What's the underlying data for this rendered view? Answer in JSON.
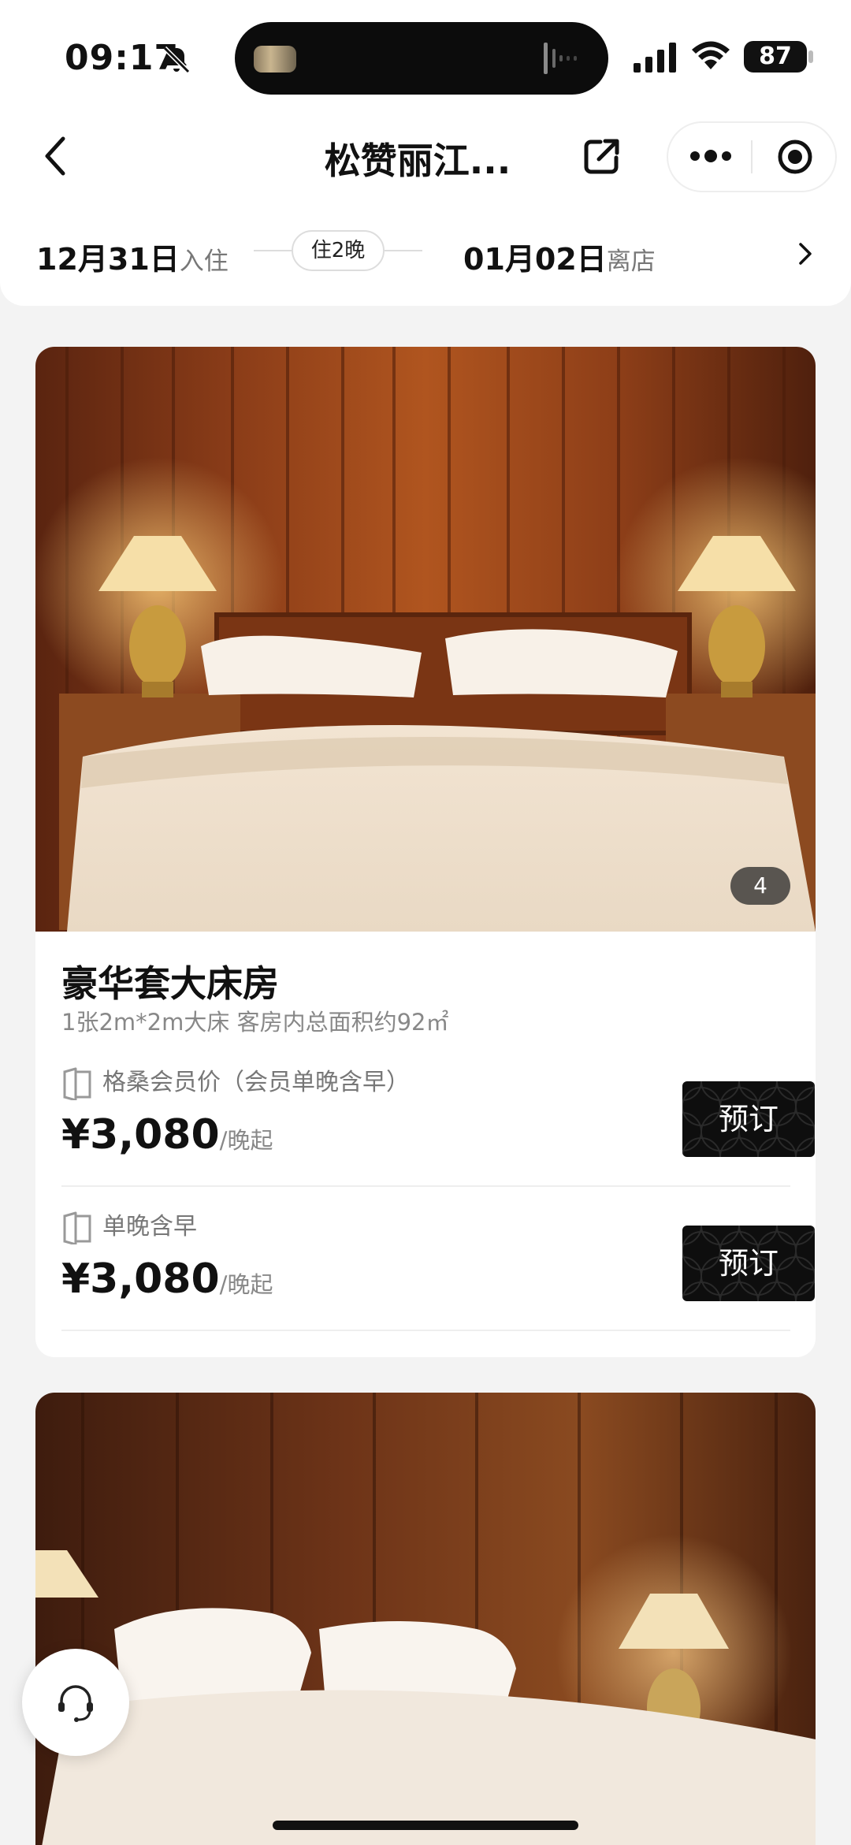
{
  "status_bar": {
    "time": "09:17",
    "battery": "87",
    "icons": [
      "bell-slash-icon",
      "signal-icon",
      "wifi-icon",
      "battery-icon"
    ]
  },
  "nav": {
    "title": "松赞丽江...",
    "icons": [
      "back-icon",
      "share-icon",
      "more-icon",
      "target-icon"
    ]
  },
  "dates": {
    "checkin_date": "12月31日",
    "checkin_label": "入住",
    "nights": "住2晚",
    "checkout_date": "01月02日",
    "checkout_label": "离店"
  },
  "rooms": [
    {
      "photo_count": "4",
      "name": "豪华套大床房",
      "description": "1张2m*2m大床 客房内总面积约92㎡",
      "rates": [
        {
          "label": "格桑会员价（会员单晚含早）",
          "price": "¥3,080",
          "unit": "/晚起",
          "book_label": "预订"
        },
        {
          "label": "单晚含早",
          "price": "¥3,080",
          "unit": "/晚起",
          "book_label": "预订"
        }
      ]
    }
  ],
  "colors": {
    "background": "#f3f3f3",
    "card": "#ffffff",
    "button": "#0e0e0e",
    "muted_text": "#888888"
  }
}
